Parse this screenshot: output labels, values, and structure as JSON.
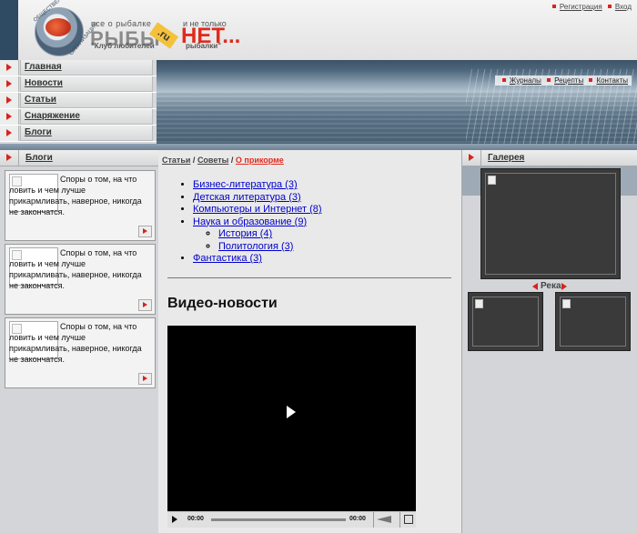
{
  "header": {
    "logo_ring_text_top": "ОБЩЕСТВЕННАЯ",
    "logo_ring_text_bottom": "ОРГАНИЗАЦИЯ",
    "tagline_left": "все  о  рыбалке",
    "brand_left": "РЫБЫ",
    "brand_ru": ".ru",
    "tagline_right": "и не только",
    "brand_right": "НЕТ...",
    "club_left": "\"Клуб любителей",
    "club_right": "рыбалки\"",
    "top_links": [
      "Регистрация",
      "Вход"
    ]
  },
  "nav": {
    "items": [
      "Главная",
      "Новости",
      "Статьи",
      "Снаряжение",
      "Блоги"
    ]
  },
  "banner": {
    "links": [
      "Журналы",
      "Рецепты",
      "Контакты"
    ]
  },
  "left": {
    "title": "Блоги",
    "cards": [
      {
        "text": "Споры о том, на что ловить и чем лучше прикармливать, наверное, никогда не закончатся."
      },
      {
        "text": "Споры о том, на что ловить и чем лучше прикармливать, наверное, никогда не закончатся."
      },
      {
        "text": "Споры о том, на что ловить и чем лучше прикармливать, наверное, никогда не закончатся."
      }
    ]
  },
  "middle": {
    "breadcrumb": {
      "item1": "Статьи",
      "item2": "Советы",
      "current": "О прикорме",
      "sep": "/"
    },
    "categories": [
      "Бизнес-литература (3)",
      "Детская литература (3)",
      "Компьютеры и Интернет (8)",
      "Наука и образование (9)"
    ],
    "subcategories": [
      "История (4)",
      "Политология (3)"
    ],
    "last_category": "Фантастика (3)",
    "video_title": "Видео-новости",
    "video": {
      "time_current": "00:00",
      "time_total": "00:00"
    }
  },
  "right": {
    "title": "Галерея",
    "caption": "Река"
  },
  "colors": {
    "accent_red": "#e02a1c",
    "link_blue": "#0000cc",
    "dark_blue": "#2f4a63"
  }
}
